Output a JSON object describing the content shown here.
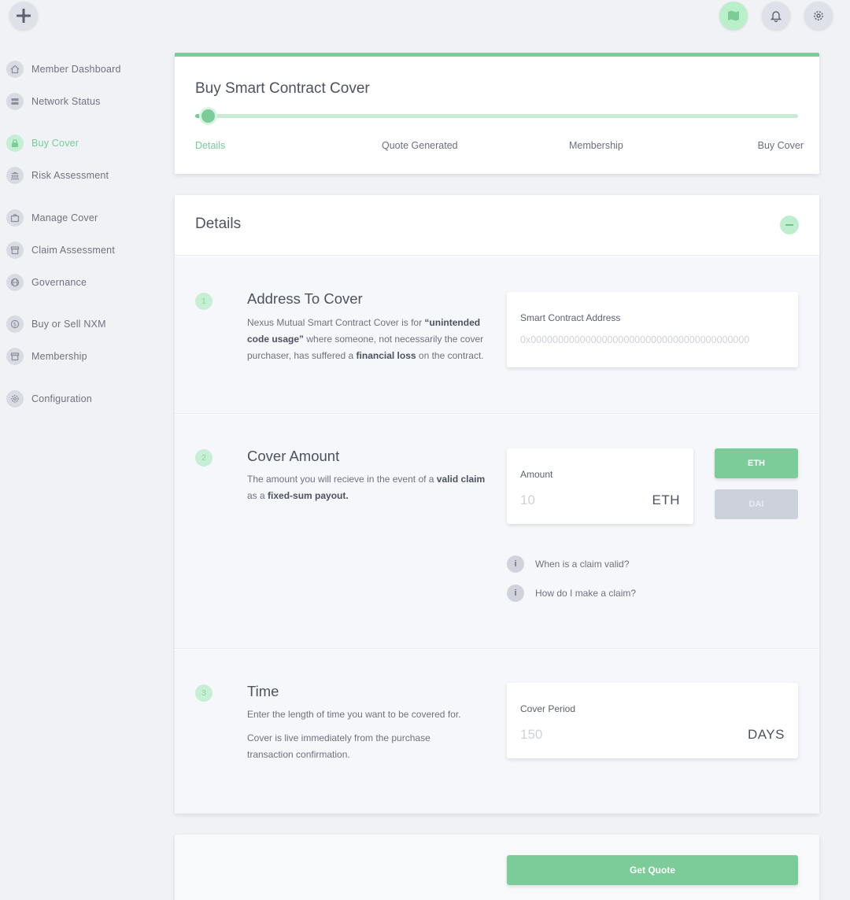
{
  "colors": {
    "accent": "#7ccc9a",
    "accent_light": "#c7ecd4",
    "muted": "#cdd1dc"
  },
  "header": {
    "logo_icon": "plus-logo-icon",
    "icons": [
      "map-icon",
      "bell-icon",
      "gear-icon"
    ]
  },
  "sidebar": {
    "items": [
      {
        "label": "Member Dashboard",
        "icon": "home-icon"
      },
      {
        "label": "Network Status",
        "icon": "server-icon"
      },
      {
        "label": "Buy Cover",
        "icon": "lock-icon",
        "active": true
      },
      {
        "label": "Risk Assessment",
        "icon": "bank-icon"
      },
      {
        "label": "Manage Cover",
        "icon": "briefcase-icon"
      },
      {
        "label": "Claim Assessment",
        "icon": "archive-icon"
      },
      {
        "label": "Governance",
        "icon": "globe-icon"
      },
      {
        "label": "Buy or Sell NXM",
        "icon": "dollar-icon"
      },
      {
        "label": "Membership",
        "icon": "archive-icon"
      },
      {
        "label": "Configuration",
        "icon": "gear-icon"
      }
    ]
  },
  "progress": {
    "title": "Buy Smart Contract Cover",
    "steps": [
      "Details",
      "Quote Generated",
      "Membership",
      "Buy Cover"
    ],
    "current_step": 0
  },
  "details": {
    "title": "Details",
    "address": {
      "number": "1",
      "title": "Address To Cover",
      "text_1": "Nexus Mutual Smart Contract Cover is for",
      "text_bold_1": "“unintended code usage”",
      "text_2": " where someone, not necessarily the cover purchaser, has suffered a ",
      "text_bold_2": "financial loss",
      "text_3": " on the contract.",
      "field_label": "Smart Contract Address",
      "field_placeholder": "0x0000000000000000000000000000000000000000"
    },
    "amount": {
      "number": "2",
      "title": "Cover Amount",
      "text_1": "The amount you will recieve in the event of a ",
      "text_bold_1": "valid claim",
      "text_2": " as a ",
      "text_bold_2": "fixed-sum payout.",
      "field_label": "Amount",
      "field_placeholder": "10",
      "unit": "ETH",
      "currency_eth": "ETH",
      "currency_dai": "DAI",
      "info_1": "When is a claim valid?",
      "info_2": "How do I make a claim?",
      "info_icon_text": "i"
    },
    "time": {
      "number": "3",
      "title": "Time",
      "text_1": "Enter the length of time you want to be covered for.",
      "text_2": "Cover is live immediately from the purchase transaction confirmation.",
      "field_label": "Cover Period",
      "field_placeholder": "150",
      "unit": "DAYS"
    }
  },
  "actions": {
    "get_quote": "Get Quote"
  }
}
